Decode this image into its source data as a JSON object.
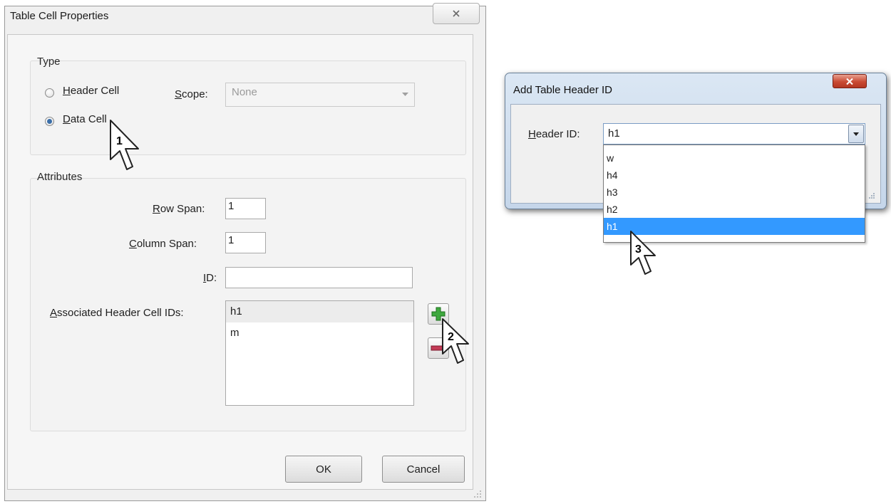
{
  "dialog1": {
    "title": "Table Cell Properties",
    "type_group": {
      "label": "Type",
      "header_cell": {
        "mnemonic": "H",
        "rest": "eader Cell",
        "selected": false
      },
      "data_cell": {
        "mnemonic": "D",
        "rest": "ata Cell",
        "selected": true
      },
      "scope": {
        "mnemonic": "S",
        "rest": "cope:",
        "value": "None",
        "disabled": true
      }
    },
    "attributes_group": {
      "label": "Attributes",
      "row_span": {
        "mnemonic": "R",
        "rest": "ow Span:",
        "value": "1"
      },
      "column_span": {
        "mnemonic": "C",
        "rest": "olumn Span:",
        "value": "1"
      },
      "id": {
        "mnemonic": "I",
        "rest": "D:",
        "value": ""
      },
      "associated": {
        "mnemonic": "A",
        "rest": "ssociated Header Cell IDs:",
        "items": [
          "h1",
          "m"
        ]
      }
    },
    "ok_label": "OK",
    "cancel_label": "Cancel"
  },
  "dialog2": {
    "title": "Add Table Header ID",
    "header_id": {
      "mnemonic": "H",
      "rest": "eader ID:",
      "value": "h1"
    },
    "options": [
      "w",
      "h4",
      "h3",
      "h2",
      "h1"
    ],
    "highlighted_option": "h1"
  },
  "callouts": [
    "1",
    "2",
    "3"
  ],
  "colors": {
    "selection_blue": "#3399ff",
    "plus_green": "#3ea83e",
    "minus_red": "#c23a55",
    "close_red": "#c94a33"
  }
}
